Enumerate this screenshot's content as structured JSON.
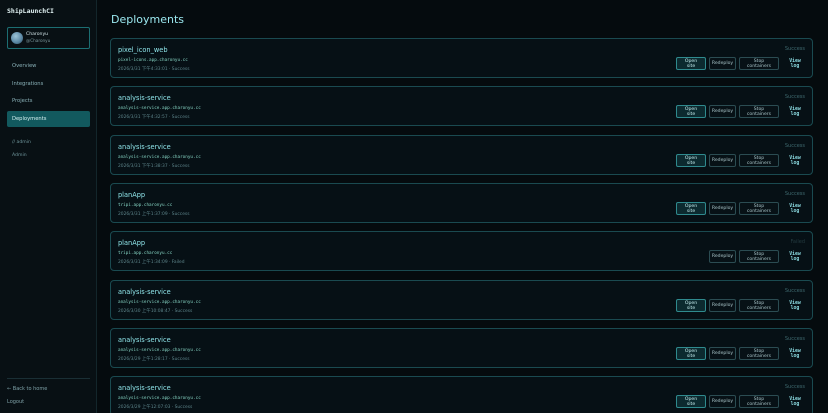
{
  "brand": "ShipLaunchCI",
  "user": {
    "name": "Charonyu",
    "handle": "@Charonyu"
  },
  "nav": [
    "Overview",
    "Integrations",
    "Projects",
    "Deployments"
  ],
  "nav_sub": [
    "// admin",
    "Admin"
  ],
  "sidebar_bottom": {
    "back": "← Back to home",
    "logout": "Logout"
  },
  "page": {
    "title": "Deployments"
  },
  "actions": {
    "open": "Open site",
    "redeploy": "Redeploy",
    "stop": "Stop containers",
    "log": "View log"
  },
  "colors": {
    "accent": "#12595e",
    "status_success": "#3f6a70",
    "status_failed": "#233a3f"
  },
  "deployments": [
    {
      "name": "pixel_icon_web",
      "url": "pixel-icons.app.charonyu.cc",
      "meta": "2026/3/31 下午4:33:01 · Success",
      "status": "Success",
      "has_open": true
    },
    {
      "name": "analysis-service",
      "url": "analysis-service.app.charonyu.cc",
      "meta": "2026/3/31 下午4:32:57 · Success",
      "status": "Success",
      "has_open": true
    },
    {
      "name": "analysis-service",
      "url": "analysis-service.app.charonyu.cc",
      "meta": "2026/3/31 下午1:38:37 · Success",
      "status": "Success",
      "has_open": true
    },
    {
      "name": "planApp",
      "url": "tripi.app.charonyu.cc",
      "meta": "2026/3/31 上午1:37:09 · Success",
      "status": "Success",
      "has_open": true
    },
    {
      "name": "planApp",
      "url": "tripi.app.charonyu.cc",
      "meta": "2026/3/31 上午1:34:09 · Failed",
      "status": "Failed",
      "has_open": false
    },
    {
      "name": "analysis-service",
      "url": "analysis-service.app.charonyu.cc",
      "meta": "2026/3/30 上午10:08:47 · Success",
      "status": "Success",
      "has_open": true
    },
    {
      "name": "analysis-service",
      "url": "analysis-service.app.charonyu.cc",
      "meta": "2026/3/29 上午1:28:17 · Success",
      "status": "Success",
      "has_open": true
    },
    {
      "name": "analysis-service",
      "url": "analysis-service.app.charonyu.cc",
      "meta": "2026/3/29 上午12:07:03 · Success",
      "status": "Success",
      "has_open": true
    }
  ]
}
